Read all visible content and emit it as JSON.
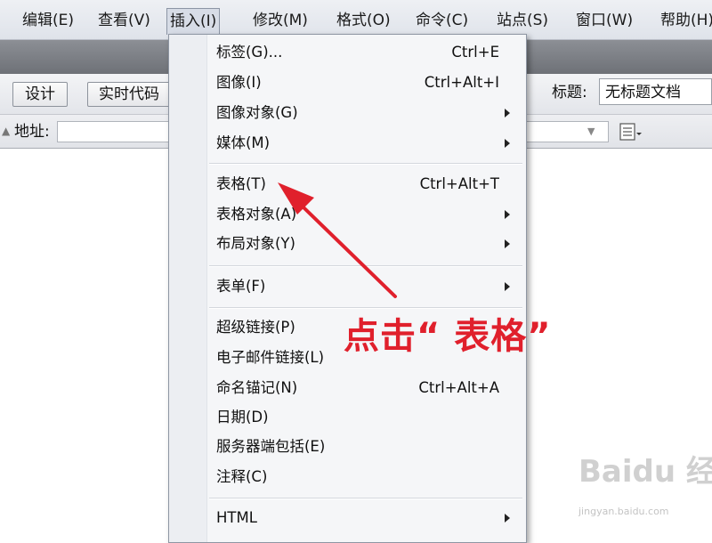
{
  "menubar": {
    "items": [
      "编辑(E)",
      "查看(V)",
      "插入(I)",
      "修改(M)",
      "格式(O)",
      "命令(C)",
      "站点(S)",
      "窗口(W)",
      "帮助(H)"
    ],
    "active": "插入(I)"
  },
  "toolbar": {
    "design_label": "设计",
    "live_code_label": "实时代码",
    "title_label": "标题:",
    "title_value": "无标题文档"
  },
  "address": {
    "label": "地址:",
    "value": ""
  },
  "insert_menu": {
    "items": [
      {
        "label": "标签(G)...",
        "shortcut": "Ctrl+E",
        "submenu": false
      },
      {
        "label": "图像(I)",
        "shortcut": "Ctrl+Alt+I",
        "submenu": false
      },
      {
        "label": "图像对象(G)",
        "shortcut": "",
        "submenu": true
      },
      {
        "label": "媒体(M)",
        "shortcut": "",
        "submenu": true
      },
      {
        "label": "表格(T)",
        "shortcut": "Ctrl+Alt+T",
        "submenu": false
      },
      {
        "label": "表格对象(A)",
        "shortcut": "",
        "submenu": true
      },
      {
        "label": "布局对象(Y)",
        "shortcut": "",
        "submenu": true
      },
      {
        "label": "表单(F)",
        "shortcut": "",
        "submenu": true
      },
      {
        "label": "超级链接(P)",
        "shortcut": "",
        "submenu": false
      },
      {
        "label": "电子邮件链接(L)",
        "shortcut": "",
        "submenu": false
      },
      {
        "label": "命名锚记(N)",
        "shortcut": "Ctrl+Alt+A",
        "submenu": false
      },
      {
        "label": "日期(D)",
        "shortcut": "",
        "submenu": false
      },
      {
        "label": "服务器端包括(E)",
        "shortcut": "",
        "submenu": false
      },
      {
        "label": "注释(C)",
        "shortcut": "",
        "submenu": false
      },
      {
        "label": "HTML",
        "shortcut": "",
        "submenu": true
      }
    ]
  },
  "annotation": {
    "text": "点击“ 表格”",
    "color": "#e0202c"
  },
  "watermark": {
    "text": "Baidu 经验",
    "sub": "jingyan.baidu.com"
  }
}
